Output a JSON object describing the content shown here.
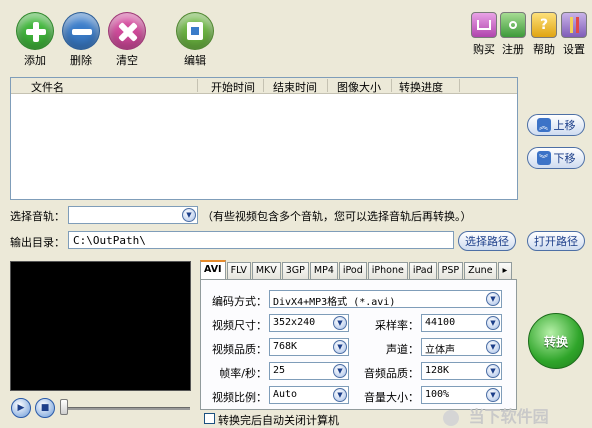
{
  "toolbar": {
    "add": "添加",
    "delete": "删除",
    "clear": "清空",
    "edit": "编辑",
    "buy": "购买",
    "register": "注册",
    "help": "帮助",
    "settings": "设置",
    "help_glyph": "?"
  },
  "file_list": {
    "columns": [
      "文件名",
      "开始时间",
      "结束时间",
      "图像大小",
      "转换进度"
    ]
  },
  "side": {
    "move_up": "上移",
    "move_down": "下移",
    "up_glyph": "︽",
    "down_glyph": "︾"
  },
  "audio_track": {
    "label": "选择音轨：",
    "value": "",
    "hint": "（有些视频包含多个音轨，您可以选择音轨后再转换。）"
  },
  "output": {
    "label": "输出目录：",
    "path": "C:\\OutPath\\",
    "choose_btn": "选择路径",
    "open_btn": "打开路径"
  },
  "tabs": [
    "AVI",
    "FLV",
    "MKV",
    "3GP",
    "MP4",
    "iPod",
    "iPhone",
    "iPad",
    "PSP",
    "Zune"
  ],
  "tab_next": "▸",
  "settings_panel": {
    "encoding_label": "编码方式：",
    "encoding_value": "DivX4+MP3格式 (*.avi)",
    "size_label": "视频尺寸：",
    "size_value": "352x240",
    "samplerate_label": "采样率：",
    "samplerate_value": "44100",
    "vquality_label": "视频品质：",
    "vquality_value": "768K",
    "channel_label": "声道：",
    "channel_value": "立体声",
    "fps_label": "帧率/秒：",
    "fps_value": "25",
    "aquality_label": "音频品质：",
    "aquality_value": "128K",
    "ratio_label": "视频比例：",
    "ratio_value": "Auto",
    "volume_label": "音量大小：",
    "volume_value": "100%"
  },
  "shutdown_label": "转换完后自动关闭计算机",
  "convert_btn": "转换",
  "player": {
    "play_glyph": "▶",
    "stop_glyph": "■"
  },
  "watermark": "当下软件园"
}
